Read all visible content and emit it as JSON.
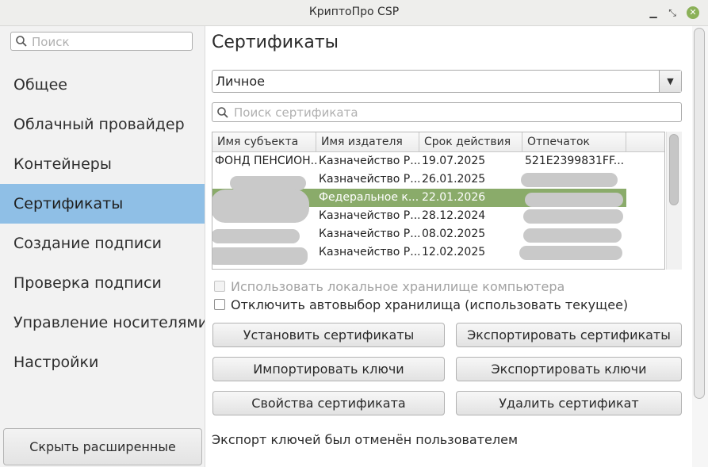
{
  "window": {
    "title": "КриптоПро CSP",
    "controls": [
      "minimize",
      "restore",
      "close"
    ]
  },
  "sidebar": {
    "search_placeholder": "Поиск",
    "items": [
      {
        "label": "Общее",
        "active": false
      },
      {
        "label": "Облачный провайдер",
        "active": false
      },
      {
        "label": "Контейнеры",
        "active": false
      },
      {
        "label": "Сертификаты",
        "active": true
      },
      {
        "label": "Создание подписи",
        "active": false
      },
      {
        "label": "Проверка подписи",
        "active": false
      },
      {
        "label": "Управление носителями",
        "active": false
      },
      {
        "label": "Настройки",
        "active": false
      }
    ],
    "hide_button": "Скрыть расширенные"
  },
  "main": {
    "title": "Сертификаты",
    "store_select": "Личное",
    "search_placeholder": "Поиск сертификата",
    "table": {
      "columns": [
        "Имя субъекта",
        "Имя издателя",
        "Срок действия",
        "Отпечаток"
      ],
      "rows": [
        {
          "subject": "ФОНД ПЕНСИОН...",
          "issuer": "Казначейство Р...",
          "expires": "19.07.2025",
          "thumbprint": "521E2399831FF...",
          "selected": false
        },
        {
          "subject": "",
          "issuer": "Казначейство Р...",
          "expires": "26.01.2025",
          "thumbprint": "",
          "selected": false
        },
        {
          "subject": "",
          "issuer": "Федеральное к...",
          "expires": "22.01.2026",
          "thumbprint": "",
          "selected": true
        },
        {
          "subject": "",
          "issuer": "Казначейство Р...",
          "expires": "28.12.2024",
          "thumbprint": "",
          "selected": false
        },
        {
          "subject": "",
          "issuer": "Казначейство Р...",
          "expires": "08.02.2025",
          "thumbprint": "",
          "selected": false
        },
        {
          "subject": "",
          "issuer": "Казначейство Р...",
          "expires": "12.02.2025",
          "thumbprint": "",
          "selected": false
        }
      ]
    },
    "checkboxes": [
      {
        "label": "Использовать локальное хранилище компьютера",
        "checked": false,
        "disabled": true
      },
      {
        "label": "Отключить автовыбор хранилища (использовать текущее)",
        "checked": false,
        "disabled": false
      }
    ],
    "buttons": {
      "install": "Установить сертификаты",
      "export_certs": "Экспортировать сертификаты",
      "import_keys": "Импортировать ключи",
      "export_keys": "Экспортировать ключи",
      "properties": "Свойства сертификата",
      "delete": "Удалить сертификат"
    },
    "status": "Экспорт ключей был отменён пользователем"
  },
  "colors": {
    "selection": "#8fbfe6",
    "row_selected": "#8aab6a",
    "close_button": "#8bb158"
  }
}
